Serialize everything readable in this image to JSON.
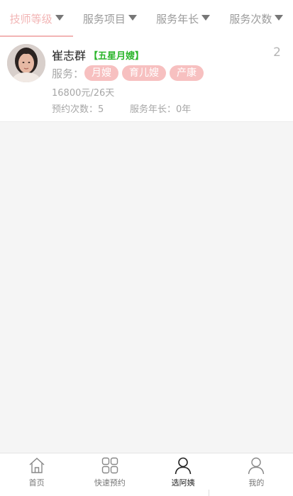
{
  "filters": [
    {
      "label": "技师等级",
      "active": true
    },
    {
      "label": "服务项目",
      "active": false
    },
    {
      "label": "服务年长",
      "active": false
    },
    {
      "label": "服务次数",
      "active": false
    }
  ],
  "card": {
    "name": "崔志群",
    "level": "【五星月嫂】",
    "count": "2",
    "service_label": "服务：",
    "tags": [
      "月嫂",
      "育儿嫂",
      "产康"
    ],
    "price": "16800元/26天",
    "bookings": "预约次数：5",
    "years": "服务年长：0年"
  },
  "tabbar": [
    {
      "label": "首页",
      "icon": "home-icon"
    },
    {
      "label": "快速预约",
      "icon": "grid-icon"
    },
    {
      "label": "选阿姨",
      "icon": "person-icon"
    },
    {
      "label": "我的",
      "icon": "profile-icon"
    }
  ],
  "colors": {
    "accent": "#f2b5b5",
    "tag": "#f7c0c0",
    "level": "#2bb52b"
  }
}
